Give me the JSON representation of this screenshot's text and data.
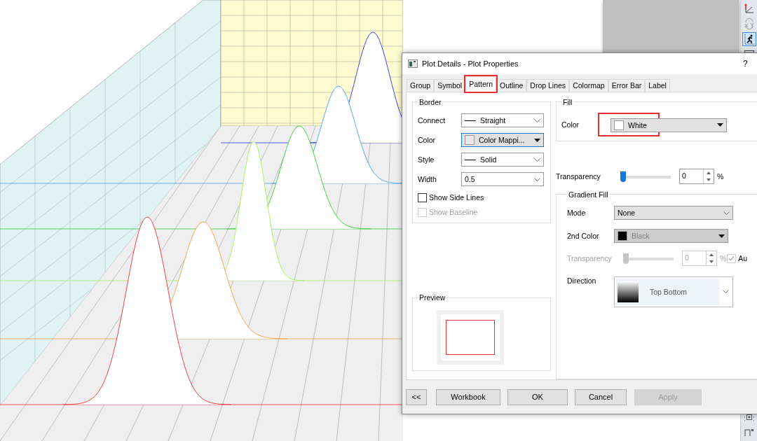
{
  "dialog": {
    "title": "Plot Details - Plot Properties",
    "help": "?",
    "tabs": [
      {
        "label": "Group",
        "selected": false,
        "highlighted": false
      },
      {
        "label": "Symbol",
        "selected": false,
        "highlighted": false
      },
      {
        "label": "Pattern",
        "selected": true,
        "highlighted": true
      },
      {
        "label": "Outline",
        "selected": false,
        "highlighted": false
      },
      {
        "label": "Drop Lines",
        "selected": false,
        "highlighted": false
      },
      {
        "label": "Colormap",
        "selected": false,
        "highlighted": false
      },
      {
        "label": "Error Bar",
        "selected": false,
        "highlighted": false
      },
      {
        "label": "Label",
        "selected": false,
        "highlighted": false
      }
    ],
    "border": {
      "title": "Border",
      "fields": [
        {
          "kind": "line",
          "label": "Connect",
          "value": "Straight"
        },
        {
          "kind": "swatch",
          "label": "Color",
          "value": "Color Mappi...",
          "focused": true
        },
        {
          "kind": "line",
          "label": "Style",
          "value": "Solid"
        },
        {
          "kind": "plain",
          "label": "Width",
          "value": "0.5"
        }
      ],
      "checkboxes": [
        {
          "label": "Show Side Lines",
          "checked": false,
          "disabled": false
        },
        {
          "label": "Show Baseline",
          "checked": false,
          "disabled": true
        }
      ]
    },
    "preview": {
      "title": "Preview"
    },
    "fill": {
      "title": "Fill",
      "label": "Color",
      "value": "White",
      "highlighted": true
    },
    "transparency": {
      "label": "Transparency",
      "level": 0,
      "value": "0",
      "unit": "%"
    },
    "gradient": {
      "title": "Gradient Fill",
      "mode_label": "Mode",
      "mode": "None",
      "second_label": "2nd Color",
      "second_value": "Black",
      "second_disabled": true,
      "transparency": {
        "label": "Transparency",
        "level": 0,
        "value": "0",
        "unit": "%",
        "disabled": true,
        "auto_label": "Au",
        "auto_checked": true
      },
      "direction_label": "Direction",
      "direction": "Top Bottom"
    },
    "buttons": [
      {
        "label": "<<",
        "disabled": false
      },
      {
        "label": "Workbook",
        "disabled": false
      },
      {
        "label": "OK",
        "disabled": false
      },
      {
        "label": "Cancel",
        "disabled": false
      },
      {
        "label": "Apply",
        "disabled": true
      }
    ]
  },
  "toolbar_top": [
    {
      "kind": "axis",
      "selected": false
    },
    {
      "kind": "swap",
      "selected": false
    },
    {
      "kind": "runner",
      "selected": true
    },
    {
      "kind": "window",
      "selected": false
    }
  ],
  "toolbar_bottom": [
    {
      "kind": "frame",
      "selected": false
    },
    {
      "kind": "corner",
      "selected": false
    }
  ]
}
